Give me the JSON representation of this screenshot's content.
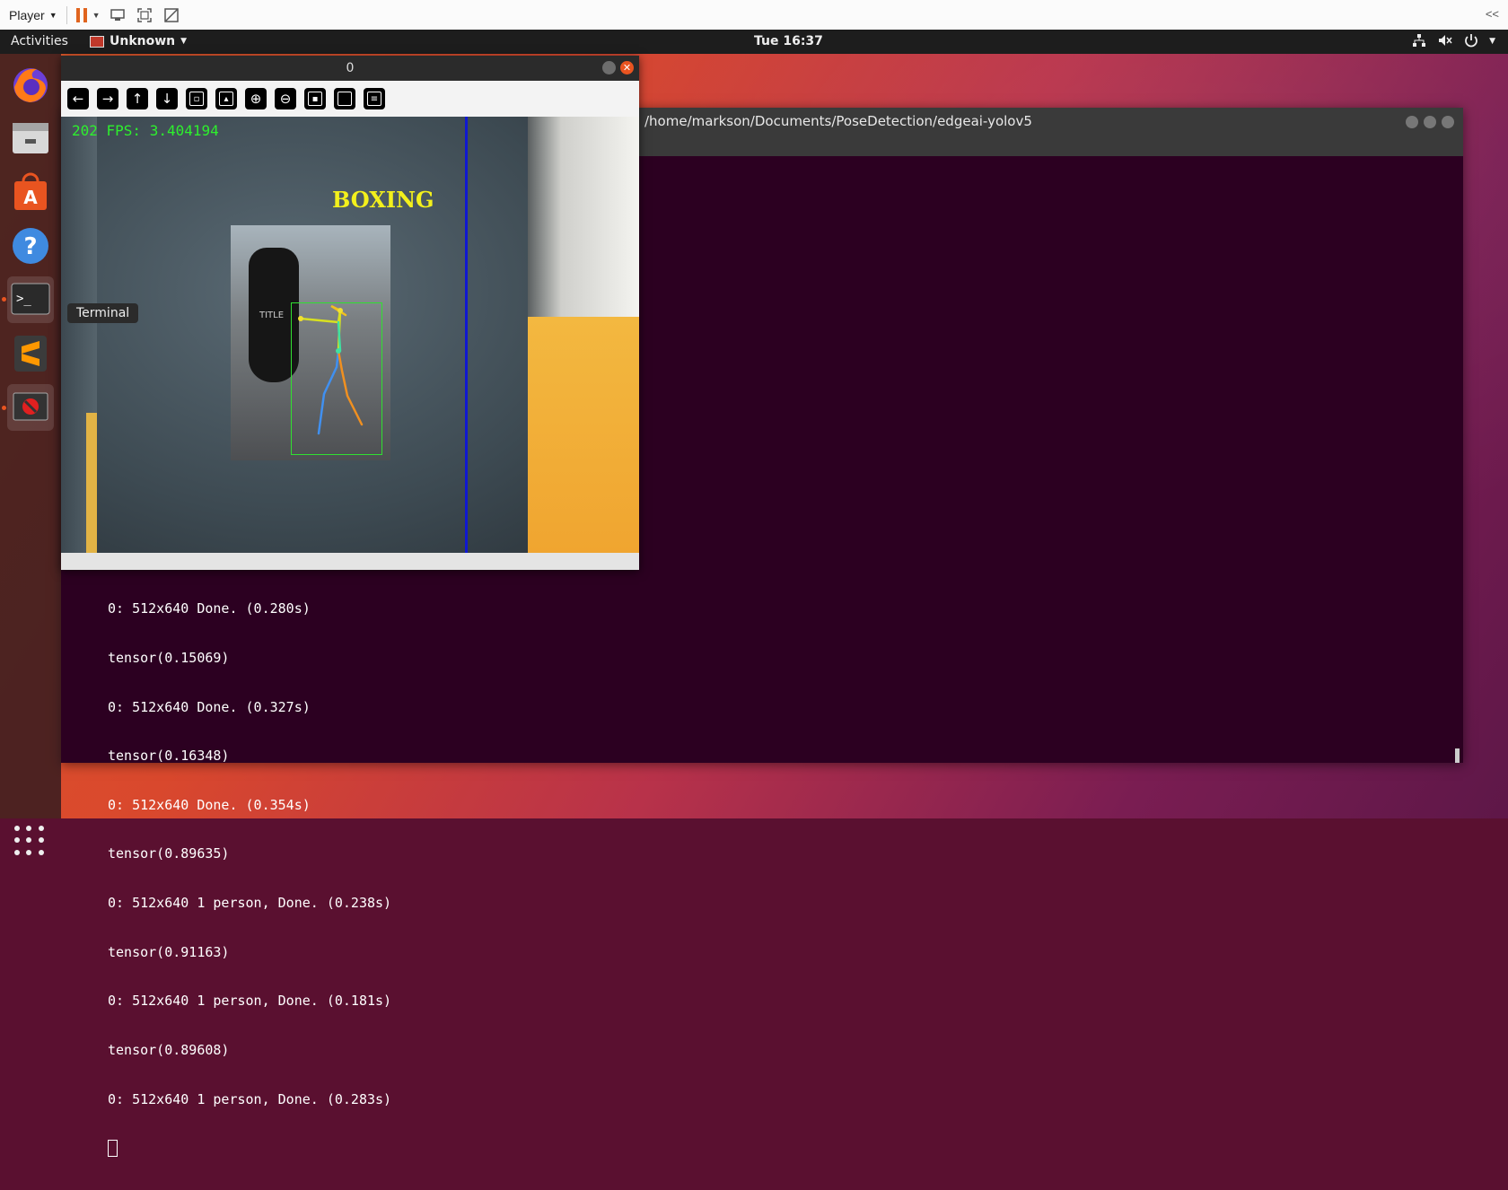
{
  "vm": {
    "player_label": "Player",
    "collapse_label": "<<"
  },
  "topbar": {
    "activities": "Activities",
    "app_name": "Unknown",
    "clock": "Tue 16:37"
  },
  "dock": {
    "tooltip": "Terminal",
    "items": [
      "firefox-icon",
      "files-icon",
      "software-icon",
      "help-icon",
      "terminal-icon",
      "sublime-text-icon",
      "disabled-app-icon"
    ]
  },
  "terminal": {
    "title": "/home/markson/Documents/PoseDetection/edgeai-yolov5",
    "lines": [
      "0: 512x640 Done. (0.280s)",
      "tensor(0.15069)",
      "0: 512x640 Done. (0.327s)",
      "tensor(0.16348)",
      "0: 512x640 Done. (0.354s)",
      "tensor(0.89635)",
      "0: 512x640 1 person, Done. (0.238s)",
      "tensor(0.91163)",
      "0: 512x640 1 person, Done. (0.181s)",
      "tensor(0.89608)",
      "0: 512x640 1 person, Done. (0.283s)"
    ]
  },
  "cv_window": {
    "title": "0",
    "toolbar": [
      "arrow-left",
      "arrow-right",
      "arrow-up",
      "arrow-down",
      "fit-image",
      "zoom-fit",
      "zoom-in",
      "zoom-out",
      "save",
      "copy",
      "properties"
    ],
    "fps_text": "202 FPS: 3.404194",
    "action_label": "BOXING"
  },
  "colors": {
    "accent": "#e95420",
    "terminal_bg": "#2c0021",
    "fps_green": "#2df02d",
    "label_yellow": "#f3f01c"
  }
}
